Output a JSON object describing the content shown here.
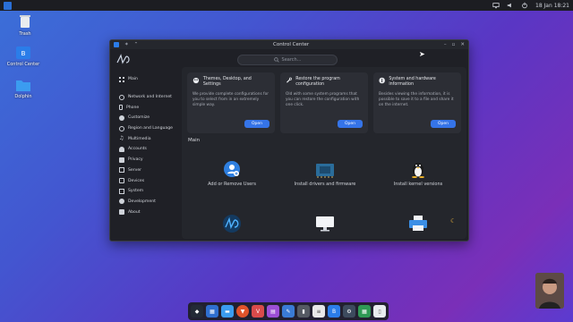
{
  "topbar": {
    "left_icon": "app-logo-icon",
    "datetime": "18 Jan 18:21",
    "icons": [
      "monitor-icon",
      "volume-icon",
      "power-icon"
    ]
  },
  "desktop": {
    "icons": [
      {
        "label": "Trash",
        "icon": "trash-icon"
      },
      {
        "label": "Control Center",
        "icon": "control-center-icon"
      },
      {
        "label": "Dolphin",
        "icon": "folder-icon"
      }
    ]
  },
  "window": {
    "title": "Control Center",
    "search_placeholder": "Search...",
    "sidebar": {
      "main_label": "Main",
      "items": [
        {
          "label": "Network and Internet",
          "icon": "network-icon"
        },
        {
          "label": "Phone",
          "icon": "phone-icon"
        },
        {
          "label": "Customize",
          "icon": "palette-icon"
        },
        {
          "label": "Region and Language",
          "icon": "globe-icon"
        },
        {
          "label": "Multimedia",
          "icon": "music-icon"
        },
        {
          "label": "Accounts",
          "icon": "users-icon"
        },
        {
          "label": "Privacy",
          "icon": "lock-icon"
        },
        {
          "label": "Server",
          "icon": "server-icon"
        },
        {
          "label": "Devices",
          "icon": "device-icon"
        },
        {
          "label": "System",
          "icon": "system-icon"
        },
        {
          "label": "Development",
          "icon": "dev-icon"
        },
        {
          "label": "About",
          "icon": "info-icon"
        }
      ]
    },
    "cards": [
      {
        "title": "Themes, Desktop, and Settings",
        "text": "We provide complete configurations for you to select from in an extremely simple way.",
        "button": "Open",
        "icon": "palette-icon"
      },
      {
        "title": "Restore the program configuration",
        "text": "Old with some system programs that you can restore the configuration with one click.",
        "button": "Open",
        "icon": "wrench-icon"
      },
      {
        "title": "System and hardware information",
        "text": "Besides viewing the information, it is possible to save it to a file and share it on the internet.",
        "button": "Open",
        "icon": "info-icon"
      }
    ],
    "section_title": "Main",
    "tiles": [
      {
        "label": "Add or Remove Users",
        "icon": "add-user-icon"
      },
      {
        "label": "Install drivers and firmware",
        "icon": "chip-icon"
      },
      {
        "label": "Install kernel versions",
        "icon": "linux-icon"
      },
      {
        "label": "",
        "icon": "big-logo-icon"
      },
      {
        "label": "",
        "icon": "monitor-icon"
      },
      {
        "label": "",
        "icon": "printer-icon"
      }
    ]
  },
  "dock": {
    "items": [
      "start-icon",
      "files-icon",
      "folder-icon",
      "browser-icon",
      "vivaldi-icon",
      "store-icon",
      "editor-icon",
      "terminal-icon",
      "doc-icon",
      "control-center-icon",
      "settings-icon",
      "sheet-icon",
      "trash-icon"
    ]
  },
  "colors": {
    "accent": "#3574e8",
    "window_bg": "#1f2026",
    "card_bg": "#2c2e35"
  }
}
